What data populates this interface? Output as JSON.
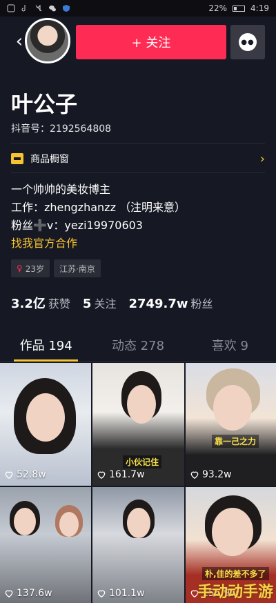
{
  "status_bar": {
    "battery": "22%",
    "time": "4:19"
  },
  "header": {
    "follow_label": "+ 关注"
  },
  "profile": {
    "name": "叶公子",
    "douyin_id": "抖音号：2192564808",
    "shop_label": "商品橱窗",
    "bio_line1": "一个帅帅的美妆博主",
    "bio_line2": "工作：zhengzhanzz （注明来意）",
    "bio_line3": "粉丝➕v：yezi19970603",
    "bio_line4": "找我官方合作",
    "tags": [
      {
        "label": "23岁",
        "icon": "female-icon"
      },
      {
        "label": "江苏·南京"
      }
    ]
  },
  "stats": [
    {
      "num": "3.2亿",
      "label": "获赞"
    },
    {
      "num": "5",
      "label": "关注"
    },
    {
      "num": "2749.7w",
      "label": "粉丝"
    }
  ],
  "tabs": [
    {
      "label": "作品 194",
      "active": true
    },
    {
      "label": "动态 278",
      "active": false
    },
    {
      "label": "喜欢 9",
      "active": false
    }
  ],
  "videos": [
    {
      "likes": "52.8w",
      "caption": ""
    },
    {
      "likes": "161.7w",
      "caption": "小伙记住"
    },
    {
      "likes": "93.2w",
      "caption": "靠一己之力"
    },
    {
      "likes": "137.6w",
      "caption": ""
    },
    {
      "likes": "101.1w",
      "caption": ""
    },
    {
      "likes": "156.9w",
      "caption": "朴,佳的差不多了"
    }
  ],
  "watermark": "手动动手游",
  "colors": {
    "accent": "#fe2c55",
    "highlight": "#f7c331",
    "background": "#161823"
  }
}
